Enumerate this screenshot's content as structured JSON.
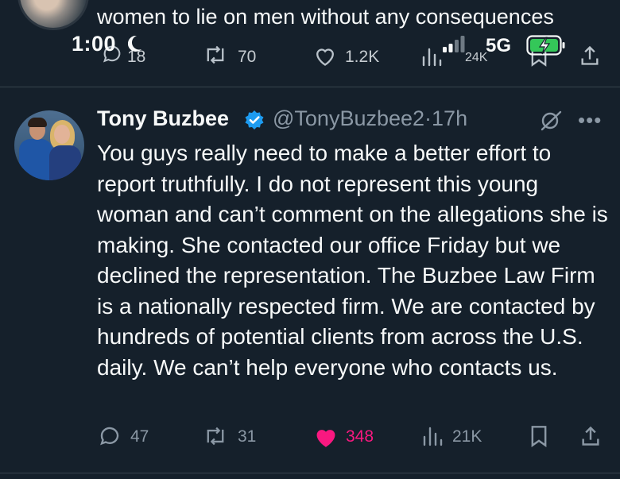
{
  "previous_tweet": {
    "text_visible": "women to lie on men without any consequences",
    "metrics": {
      "replies": "18",
      "reposts": "70",
      "likes": "1.2K",
      "views": "24K"
    }
  },
  "status_bar": {
    "time": "1:00",
    "network": "5G",
    "icons": [
      "moon-icon",
      "signal-icon",
      "battery-charging-icon"
    ]
  },
  "tweet": {
    "author": {
      "name": "Tony Buzbee",
      "handle": "@TonyBuzbee2",
      "timestamp": "17h",
      "verified": true
    },
    "text": "You guys really need to make a better effort to report truthfully. I do not represent this young woman and can’t comment on the allegations she is making. She contacted our office Friday but we declined the representation. The Buzbee Law Firm is a nationally respected firm. We are contacted by hundreds of potential clients from across the U.S. daily. We can’t help everyone who contacts us.",
    "metrics": {
      "replies": "47",
      "reposts": "31",
      "likes": "348",
      "views": "21K"
    },
    "liked": true
  },
  "colors": {
    "background": "#15202b",
    "text": "#f7f9f9",
    "muted": "#8b98a5",
    "like": "#f91880",
    "verified": "#1d9bf0",
    "battery": "#34c759"
  }
}
